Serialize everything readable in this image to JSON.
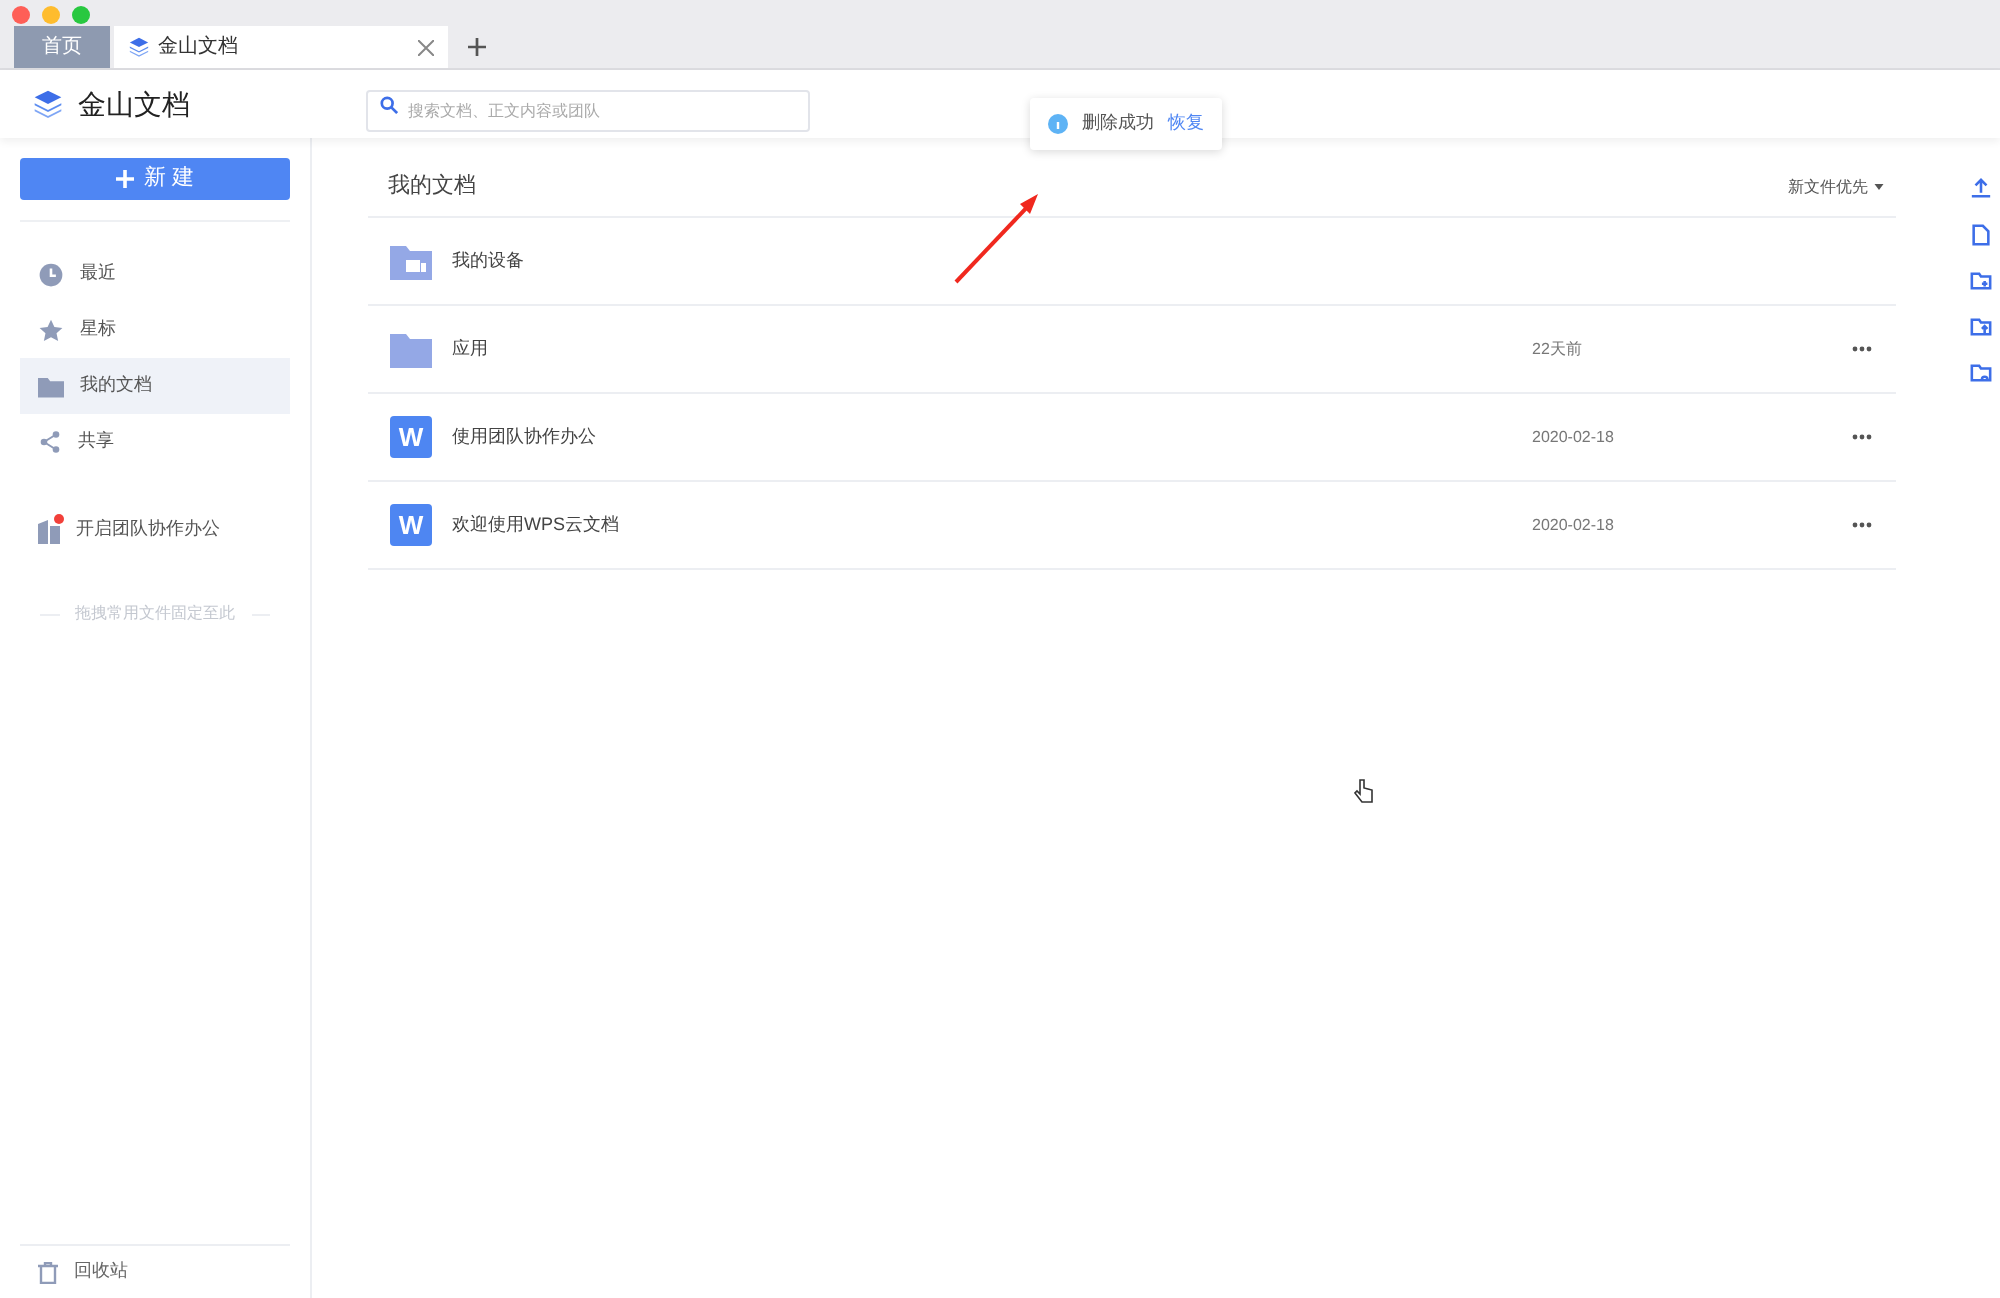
{
  "tabs": [
    {
      "label": "首页",
      "selected": false,
      "kind": "home"
    },
    {
      "label": "金山文档",
      "selected": true,
      "kind": "doc"
    }
  ],
  "header": {
    "app_name": "金山文档",
    "search": {
      "placeholder": "搜索文档、正文内容或团队"
    }
  },
  "toast": {
    "message": "删除成功",
    "action": "恢复"
  },
  "sidebar": {
    "new_button": "新 建",
    "items": [
      {
        "label": "最近",
        "kind": "clock",
        "selected": false
      },
      {
        "label": "星标",
        "kind": "star",
        "selected": false
      },
      {
        "label": "我的文档",
        "kind": "folder",
        "selected": true
      },
      {
        "label": "共享",
        "kind": "share",
        "selected": false
      }
    ],
    "team": {
      "label": "开启团队协作办公",
      "notification": true
    },
    "pin_hint": "拖拽常用文件固定至此",
    "trash": "回收站"
  },
  "main": {
    "title": "我的文档",
    "sort": "新文件优先",
    "files": [
      {
        "kind": "device",
        "name": "我的设备"
      },
      {
        "kind": "folder",
        "name": "应用",
        "date": "22天前"
      },
      {
        "kind": "doc",
        "badge": "W",
        "name": "使用团队协作办公",
        "date": "2020-02-18"
      },
      {
        "kind": "doc",
        "badge": "W",
        "name": "欢迎使用WPS云文档",
        "date": "2020-02-18"
      }
    ]
  }
}
